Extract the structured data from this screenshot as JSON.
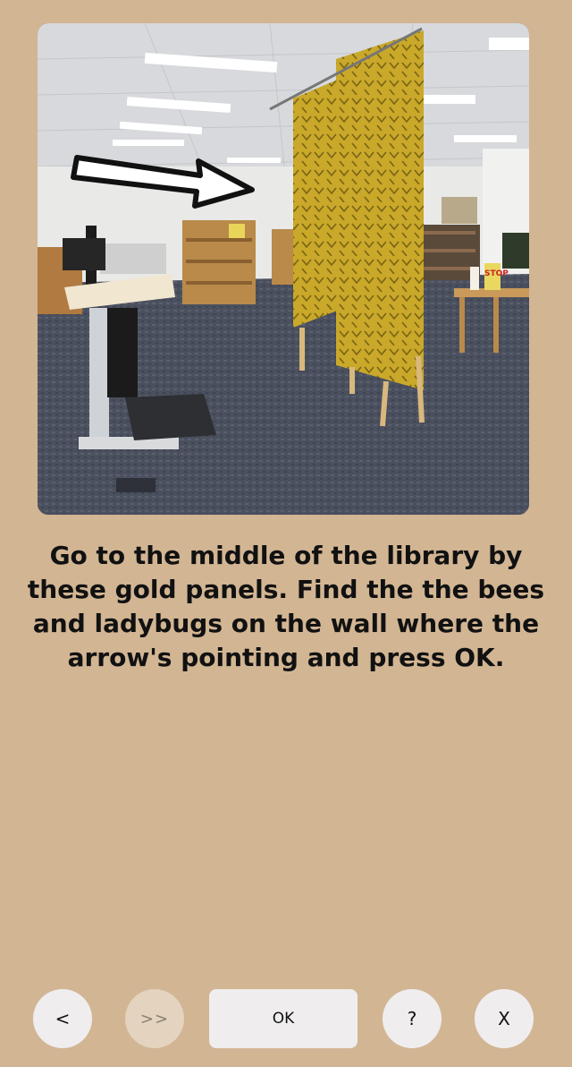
{
  "instruction": "Go to the middle of the library by these gold panels. Find the the bees and ladybugs on the wall where the arrow's pointing and press OK.",
  "photo": {
    "sign_text": "STOP"
  },
  "buttons": {
    "back": "<",
    "skip": ">>",
    "ok": "OK",
    "help": "?",
    "close": "X"
  },
  "colors": {
    "background": "#D2B593",
    "button": "#EFEDEE",
    "button_disabled": "#E3D3BF",
    "panel_gold": "#C9A82A"
  }
}
